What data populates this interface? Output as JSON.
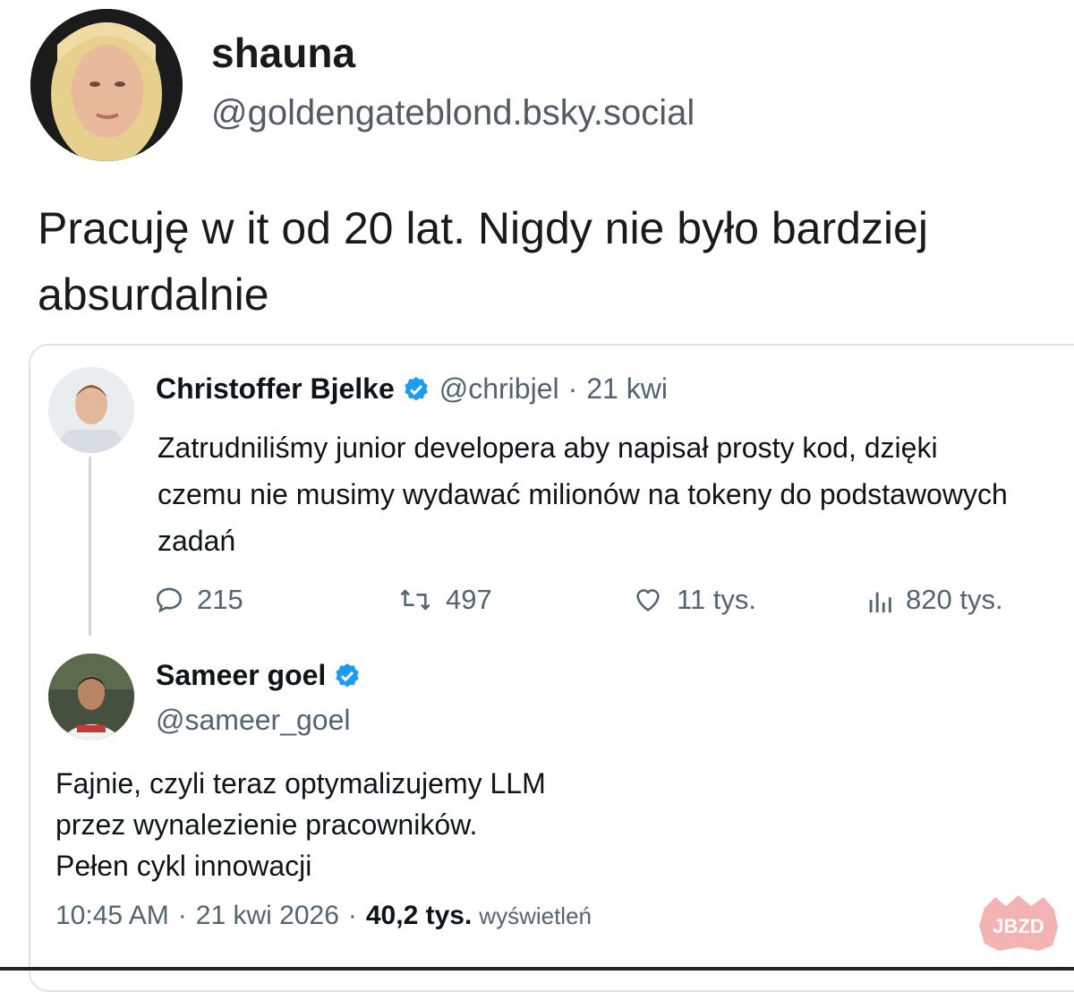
{
  "post": {
    "author_name": "shauna",
    "author_handle": "@goldengateblond.bsky.social",
    "text": "Pracuję w it od 20 lat. Nigdy nie było bardziej absurdalnie"
  },
  "quoted_tweet": {
    "author_name": "Christoffer Bjelke",
    "author_handle": "@chribjel",
    "separator": "·",
    "date": "21 kwi",
    "text": "Zatrudniliśmy junior developera aby napisał prosty kod, dzięki czemu nie musimy wydawać milionów na tokeny do podstawowych zadań",
    "actions": {
      "replies": "215",
      "reposts": "497",
      "likes": "11 tys.",
      "views": "820 tys."
    }
  },
  "reply_tweet": {
    "author_name": "Sameer goel",
    "author_handle": "@sameer_goel",
    "text_lines": [
      "Fajnie, czyli teraz optymalizujemy LLM",
      "przez wynalezienie pracowników.",
      "Pełen cykl innowacji"
    ],
    "time": "10:45 AM",
    "separator": "·",
    "date": "21 kwi 2026",
    "view_count": "40,2 tys.",
    "views_label": "wyświetleń"
  },
  "watermark_text": "JBZD",
  "colors": {
    "verified_blue": "#1d9bf0",
    "secondary_text": "#536471",
    "watermark": "#f06a6a"
  },
  "icons": [
    "reply-icon",
    "repost-icon",
    "like-icon",
    "views-icon",
    "verified-badge-icon"
  ]
}
